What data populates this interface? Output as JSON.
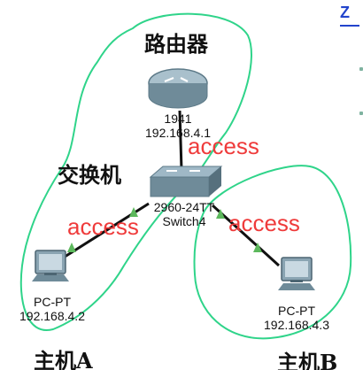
{
  "labels": {
    "router_group": "路由器",
    "switch_group": "交换机",
    "host_a_group": "主机A",
    "host_b_group": "主机B"
  },
  "router": {
    "model": "1941",
    "ip": "192.168.4.1"
  },
  "switch": {
    "model": "2960-24TT",
    "name": "Switch4"
  },
  "pc_a": {
    "type": "PC-PT",
    "ip": "192.168.4.2"
  },
  "pc_b": {
    "type": "PC-PT",
    "ip": "192.168.4.3"
  },
  "links": {
    "router_switch": "access",
    "switch_pc_a": "access",
    "switch_pc_b": "access"
  },
  "edge_mark": "Z",
  "colors": {
    "outline_green": "#2fd48a",
    "access_red": "#ef3b3b",
    "port_green": "#5cb85c",
    "cable": "#111111"
  }
}
